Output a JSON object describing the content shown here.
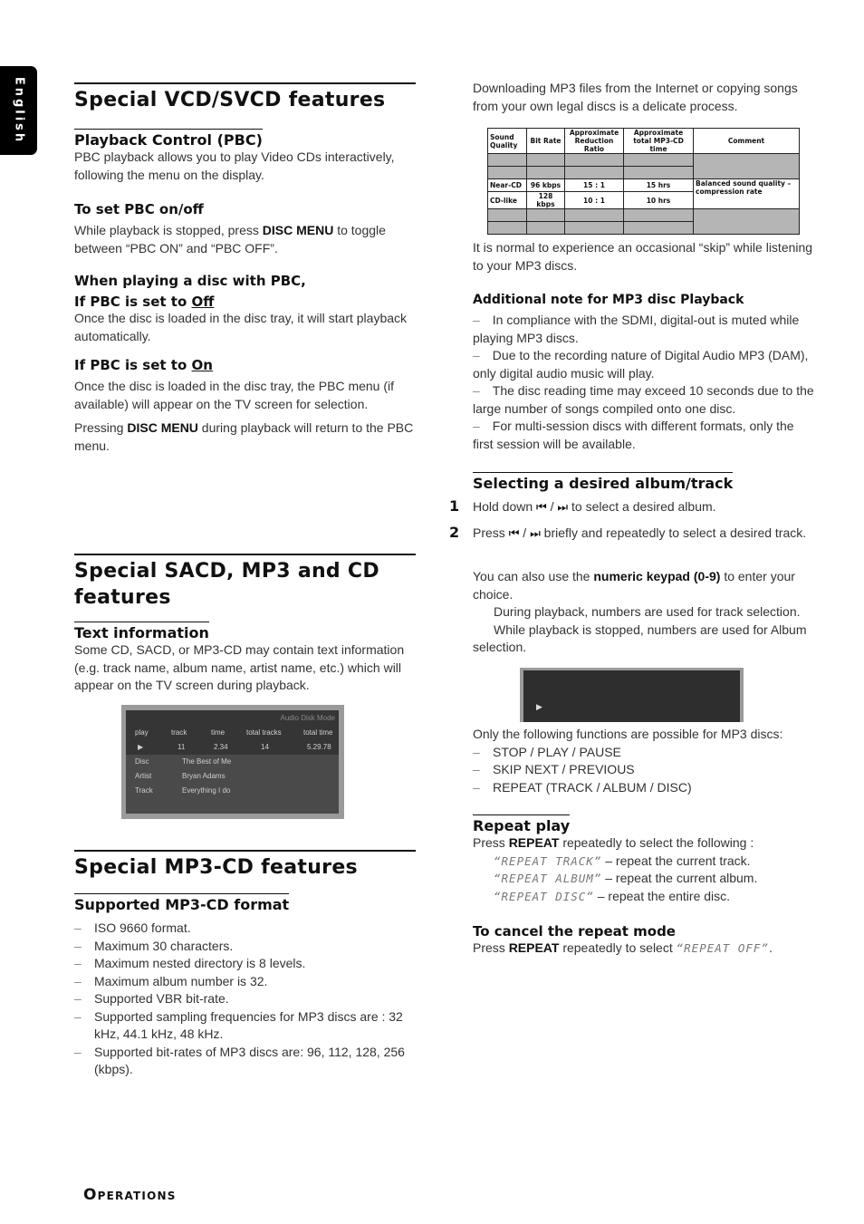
{
  "language_tab": "English",
  "left": {
    "vcd": {
      "title": "Special VCD/SVCD features",
      "pbc_heading": "Playback Control (PBC)",
      "pbc_text": "PBC playback allows you to play Video CDs interactively, following the menu on the display.",
      "set_heading": "To set PBC on/off",
      "set_text_pre": "While playback is stopped, press ",
      "set_text_bold": "DISC MENU",
      "set_text_post": " to toggle between “PBC ON” and “PBC OFF”.",
      "when_heading": "When playing a disc with PBC,",
      "off_heading_pre": "If PBC is set to ",
      "off_heading_u": "Off",
      "off_text": "Once the disc is loaded in the disc tray, it will start playback automatically.",
      "on_heading_pre": "If PBC is set to ",
      "on_heading_u": "On",
      "on_text": "Once the disc is loaded in the disc tray, the PBC menu (if available) will appear on the TV screen for selection.",
      "press_pre": "Pressing ",
      "press_bold": "DISC MENU",
      "press_post": " during playback will return to the PBC menu."
    },
    "sacd": {
      "title": "Special SACD, MP3 and CD features",
      "text_heading": "Text information",
      "text_body": "Some CD, SACD, or MP3-CD may contain text information (e.g. track name, album name, artist name, etc.) which will appear on the TV screen during playback.",
      "osd": {
        "mode": "Audio Disk Mode",
        "headers": [
          "play",
          "track",
          "time",
          "total tracks",
          "total time"
        ],
        "values": [
          "▶",
          "11",
          "2.34",
          "14",
          "5.29.78"
        ],
        "rows": [
          {
            "label": "Disc",
            "value": "The Best of Me"
          },
          {
            "label": "Artist",
            "value": "Bryan Adams"
          },
          {
            "label": "Track",
            "value": "Everything I do"
          }
        ]
      }
    },
    "mp3cd": {
      "title": "Special MP3-CD features",
      "format_heading": "Supported MP3-CD format",
      "items": [
        "ISO 9660 format.",
        "Maximum 30 characters.",
        "Maximum nested directory is 8 levels.",
        "Maximum album number is 32.",
        "Supported VBR bit-rate.",
        "Supported sampling frequencies for MP3 discs are : 32 kHz, 44.1 kHz, 48 kHz.",
        "Supported bit-rates of MP3 discs are: 96, 112, 128, 256 (kbps)."
      ]
    }
  },
  "right": {
    "intro": "Downloading MP3 files from the Internet or copying songs from your own legal discs is a delicate process.",
    "table": {
      "headers": [
        "Sound Quality",
        "Bit Rate",
        "Approximate Reduction Ratio",
        "Approximate total MP3-CD time",
        "Comment"
      ],
      "rows": [
        [
          "",
          "",
          "",
          ""
        ],
        [
          "",
          "",
          "",
          ""
        ],
        [
          "Near-CD",
          "96 kbps",
          "15 : 1",
          "15 hrs"
        ],
        [
          "CD-like",
          "128 kbps",
          "10 : 1",
          "10 hrs"
        ],
        [
          "",
          "",
          "",
          ""
        ],
        [
          "",
          "",
          "",
          ""
        ]
      ],
      "comment": "Balanced sound quality – compression rate"
    },
    "skip_text": "It is normal to experience an occasional “skip” while listening to your MP3 discs.",
    "note_heading": "Additional note for MP3 disc Playback",
    "notes": [
      "In compliance with the SDMI, digital-out is muted while playing MP3 discs.",
      "Due to the recording nature of Digital Audio MP3 (DAM), only digital audio music will play.",
      "The disc reading time may exceed 10 seconds due to the large number of songs compiled onto one disc.",
      "For multi-session discs with different formats, only the first session will be available."
    ],
    "select_heading": "Selecting a desired album/track",
    "step1_num": "1",
    "step1_pre": "Hold down ",
    "step1_post": "  to select a desired album.",
    "step2_num": "2",
    "step2_pre": "Press ",
    "step2_post": " briefly and repeatedly to select a desired track.",
    "keypad_pre": "You can also use the ",
    "keypad_bold": "numeric keypad (0-9)",
    "keypad_post": " to enter your choice.",
    "during": "During playback, numbers are used for track selection.",
    "while": "While playback is stopped, numbers are used for Album selection.",
    "only_text": "Only the following functions are possible for MP3 discs:",
    "functions": [
      "STOP / PLAY / PAUSE",
      "SKIP NEXT / PREVIOUS",
      "REPEAT (TRACK / ALBUM / DISC)"
    ],
    "repeat_heading": "Repeat play",
    "repeat_pre": "Press ",
    "repeat_bold": "REPEAT",
    "repeat_post": " repeatedly to select the following :",
    "repeat_modes": [
      {
        "lcd": "“REPEAT TRACK”",
        "desc": " – repeat the current track."
      },
      {
        "lcd": "“REPEAT ALBUM”",
        "desc": " – repeat the current album."
      },
      {
        "lcd": "“REPEAT DISC”",
        "desc": " – repeat the entire disc."
      }
    ],
    "cancel_heading": "To cancel the repeat mode",
    "cancel_pre": "Press ",
    "cancel_bold": "REPEAT",
    "cancel_mid": " repeatedly to select ",
    "cancel_lcd": "“REPEAT OFF”",
    "cancel_end": "."
  },
  "footer": {
    "first": "O",
    "rest": "PERATIONS"
  }
}
